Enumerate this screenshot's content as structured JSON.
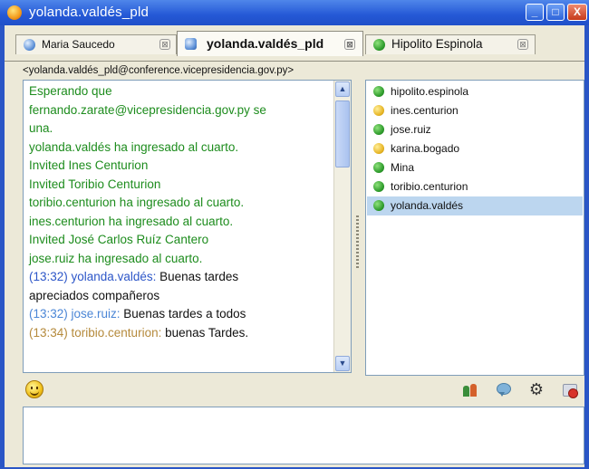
{
  "window": {
    "title": "yolanda.valdés_pld",
    "minimize_glyph": "_",
    "maximize_glyph": "□",
    "close_glyph": "X"
  },
  "tabs": [
    {
      "label": "Maria Saucedo",
      "icon": "info-icon",
      "close_glyph": "⊠",
      "active": false
    },
    {
      "label": "yolanda.valdés_pld",
      "icon": "room-icon",
      "close_glyph": "⊠",
      "active": true
    },
    {
      "label": "Hipolito Espinola",
      "icon": "status-online-icon",
      "close_glyph": "⊠",
      "active": false
    }
  ],
  "room": {
    "address": "<yolanda.valdés_pld@conference.vicepresidencia.gov.py>"
  },
  "chat": {
    "lines": [
      {
        "type": "system",
        "text": "Esperando que"
      },
      {
        "type": "system",
        "text": "fernando.zarate@vicepresidencia.gov.py se"
      },
      {
        "type": "system",
        "text": "una."
      },
      {
        "type": "system",
        "text": "yolanda.valdés ha ingresado al cuarto."
      },
      {
        "type": "system",
        "text": "Invited Ines Centurion"
      },
      {
        "type": "system",
        "text": "Invited Toribio Centurion"
      },
      {
        "type": "system",
        "text": "toribio.centurion ha ingresado al cuarto."
      },
      {
        "type": "system",
        "text": "ines.centurion ha ingresado al cuarto."
      },
      {
        "type": "system",
        "text": "Invited José Carlos Ruíz Cantero"
      },
      {
        "type": "system",
        "text": "jose.ruiz ha ingresado al cuarto."
      },
      {
        "type": "message",
        "prefix": "(13:32) yolanda.valdés:",
        "text": " Buenas tardes"
      },
      {
        "type": "continuation",
        "text": "apreciados compañeros"
      },
      {
        "type": "message2",
        "prefix": "(13:32) jose.ruiz:",
        "text": " Buenas tardes a todos"
      },
      {
        "type": "message3",
        "prefix": "(13:34) toribio.centurion:",
        "text": " buenas Tardes."
      }
    ],
    "scroll_up_glyph": "▲",
    "scroll_down_glyph": "▼"
  },
  "occupants": [
    {
      "name": "hipolito.espinola",
      "status": "online",
      "color": "#2c9a2a"
    },
    {
      "name": "ines.centurion",
      "status": "away",
      "color": "#e6b321"
    },
    {
      "name": "jose.ruiz",
      "status": "online",
      "color": "#2c9a2a"
    },
    {
      "name": "karina.bogado",
      "status": "away",
      "color": "#e6b321"
    },
    {
      "name": "Mina",
      "status": "online",
      "color": "#2c9a2a"
    },
    {
      "name": "toribio.centurion",
      "status": "online",
      "color": "#2c9a2a"
    },
    {
      "name": "yolanda.valdés",
      "status": "online",
      "color": "#2c9a2a",
      "selected": true
    }
  ],
  "toolbar": {
    "icons": [
      "smiley-icon",
      "invite-users-icon",
      "chat-bubble-icon",
      "gear-icon",
      "leave-room-icon"
    ],
    "gear_glyph": "⚙"
  },
  "colors": {
    "titlebar": "#2458d6",
    "system_text": "#1d8c1d",
    "selected_row": "#bcd6ef",
    "client_bg": "#ece9d8"
  }
}
